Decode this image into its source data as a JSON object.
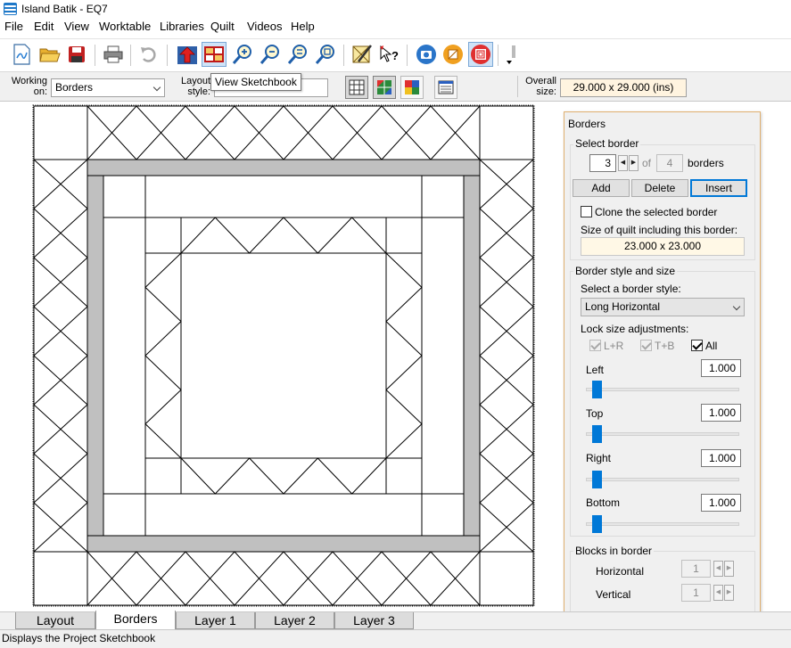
{
  "window": {
    "title": "Island Batik - EQ7"
  },
  "menu": {
    "items": [
      "File",
      "Edit",
      "View",
      "Worktable",
      "Libraries",
      "Quilt",
      "Videos",
      "Help"
    ]
  },
  "toolbar": {
    "buttons": [
      "new-project",
      "open-project",
      "save",
      "print",
      "undo",
      "add-to-sketchbook",
      "view-sketchbook",
      "zoom-in",
      "zoom-out",
      "refresh-view",
      "fit-to-worktable",
      "edit-block",
      "tool-help",
      "photo",
      "color-tool",
      "quilt-style"
    ],
    "tooltip": "View Sketchbook"
  },
  "options": {
    "working_on_label": "Working on:",
    "working_on_value": "Borders",
    "layout_style_label": "Layout style:",
    "overall_size_label": "Overall size:",
    "overall_size_value": "29.000 x 29.000 (ins)"
  },
  "palette": {
    "title": "Borders",
    "select_border": {
      "title": "Select border",
      "current": "3",
      "of_label": "of",
      "total": "4",
      "borders_label": "borders",
      "add_label": "Add",
      "delete_label": "Delete",
      "insert_label": "Insert",
      "clone_label": "Clone the selected border",
      "clone_checked": false,
      "size_label": "Size of quilt including this border:",
      "size_value": "23.000 x 23.000"
    },
    "style": {
      "title": "Border style and size",
      "select_label": "Select a border style:",
      "selected_style": "Long Horizontal",
      "lock_label": "Lock size adjustments:",
      "lock_lr": "L+R",
      "lock_tb": "T+B",
      "lock_all": "All",
      "left_label": "Left",
      "left_value": "1.000",
      "top_label": "Top",
      "top_value": "1.000",
      "right_label": "Right",
      "right_value": "1.000",
      "bottom_label": "Bottom",
      "bottom_value": "1.000"
    },
    "blocks": {
      "title": "Blocks in border",
      "horizontal_label": "Horizontal",
      "horizontal_value": "1",
      "vertical_label": "Vertical",
      "vertical_value": "1"
    }
  },
  "tabs": {
    "items": [
      "Layout",
      "Borders",
      "Layer 1",
      "Layer 2",
      "Layer 3"
    ],
    "active": "Borders"
  },
  "status": {
    "text": "Displays the Project Sketchbook"
  },
  "colors": {
    "accent": "#0078d7",
    "border_gray": "#c0c0c0",
    "palette_frame": "#e0b070"
  }
}
